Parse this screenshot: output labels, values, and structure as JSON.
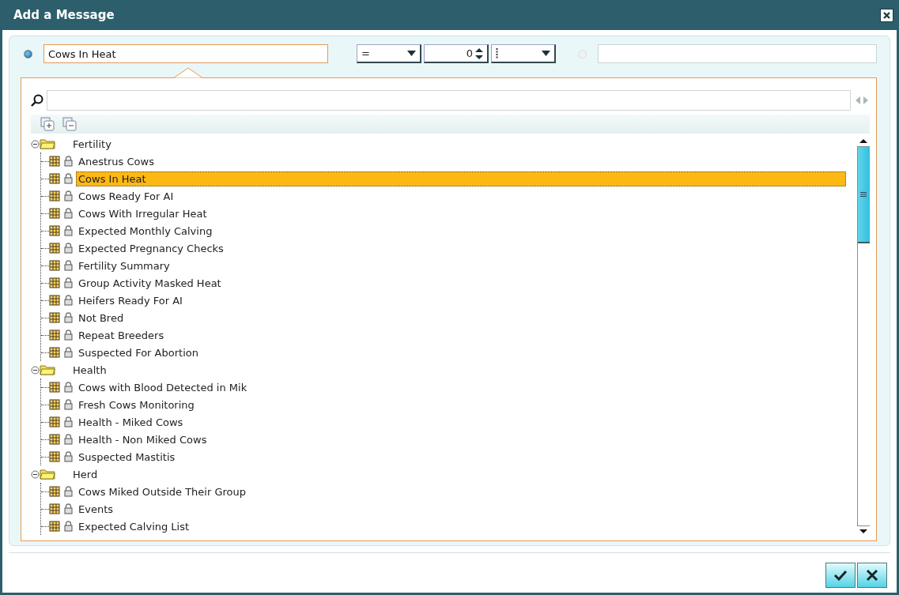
{
  "window": {
    "title": "Add a Message"
  },
  "criteria": {
    "option_a": {
      "selected": true,
      "value": "Cows In Heat"
    },
    "operator": {
      "value": "="
    },
    "number": {
      "value": "0"
    },
    "option_b": {
      "selected": false,
      "disabled": true
    }
  },
  "tree": [
    {
      "label": "Fertility",
      "expanded": true,
      "children": [
        {
          "label": "Anestrus Cows",
          "selected": false
        },
        {
          "label": "Cows In Heat",
          "selected": true
        },
        {
          "label": "Cows Ready For AI",
          "selected": false
        },
        {
          "label": "Cows With Irregular Heat",
          "selected": false
        },
        {
          "label": "Expected Monthly Calving",
          "selected": false
        },
        {
          "label": "Expected Pregnancy Checks",
          "selected": false
        },
        {
          "label": "Fertility Summary",
          "selected": false
        },
        {
          "label": "Group Activity Masked Heat",
          "selected": false
        },
        {
          "label": "Heifers Ready For AI",
          "selected": false
        },
        {
          "label": "Not Bred",
          "selected": false
        },
        {
          "label": "Repeat Breeders",
          "selected": false
        },
        {
          "label": "Suspected For Abortion",
          "selected": false
        }
      ]
    },
    {
      "label": "Health",
      "expanded": true,
      "children": [
        {
          "label": "Cows with Blood Detected in Mik",
          "selected": false
        },
        {
          "label": "Fresh Cows Monitoring",
          "selected": false
        },
        {
          "label": "Health - Miked Cows",
          "selected": false
        },
        {
          "label": "Health - Non Miked Cows",
          "selected": false
        },
        {
          "label": "Suspected Mastitis",
          "selected": false
        }
      ]
    },
    {
      "label": "Herd",
      "expanded": true,
      "children": [
        {
          "label": "Cows Miked Outside Their Group",
          "selected": false
        },
        {
          "label": "Events",
          "selected": false
        },
        {
          "label": "Expected Calving List",
          "selected": false
        }
      ]
    }
  ]
}
